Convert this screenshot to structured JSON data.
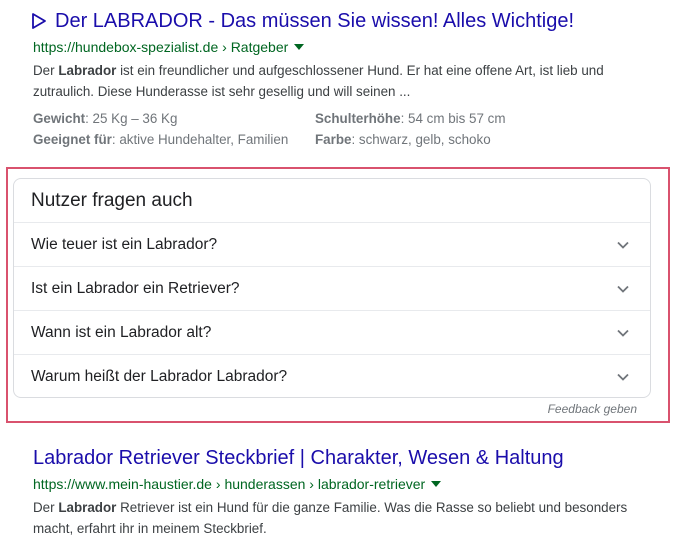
{
  "result1": {
    "title": "Der LABRADOR - Das müssen Sie wissen! Alles Wichtige!",
    "url_domain": "https://hundebox-spezialist.de",
    "url_sep": " › ",
    "url_path": "Ratgeber",
    "snippet_pre": "Der ",
    "snippet_bold": "Labrador",
    "snippet_post": " ist ein freundlicher und aufgeschlossener Hund. Er hat eine offene Art, ist lieb und zutraulich. Diese Hunderasse ist sehr gesellig und will seinen ...",
    "facts": [
      {
        "key": "Gewicht",
        "value": ": 25 Kg – 36 Kg"
      },
      {
        "key": "Schulterhöhe",
        "value": ": 54 cm bis 57 cm"
      },
      {
        "key": "Geeignet für",
        "value": ": aktive Hundehalter, Familien"
      },
      {
        "key": "Farbe",
        "value": ": schwarz, gelb, schoko"
      }
    ]
  },
  "paa": {
    "title": "Nutzer fragen auch",
    "questions": [
      "Wie teuer ist ein Labrador?",
      "Ist ein Labrador ein Retriever?",
      "Wann ist ein Labrador alt?",
      "Warum heißt der Labrador Labrador?"
    ],
    "feedback": "Feedback geben"
  },
  "result2": {
    "title": "Labrador Retriever Steckbrief | Charakter, Wesen & Haltung",
    "url_domain": "https://www.mein-haustier.de",
    "url_sep1": " › ",
    "url_path1": "hunderassen",
    "url_sep2": " › ",
    "url_path2": "labrador-retriever",
    "snippet_pre": "Der ",
    "snippet_bold": "Labrador",
    "snippet_post": " Retriever ist ein Hund für die ganze Familie. Was die Rasse so beliebt und besonders macht, erfahrt ihr in meinem Steckbrief."
  },
  "colors": {
    "link": "#1a0dab",
    "url": "#006621",
    "highlight": "#d9526e"
  },
  "icons": [
    "play-outline-icon",
    "caret-down-icon",
    "chevron-down-icon"
  ]
}
